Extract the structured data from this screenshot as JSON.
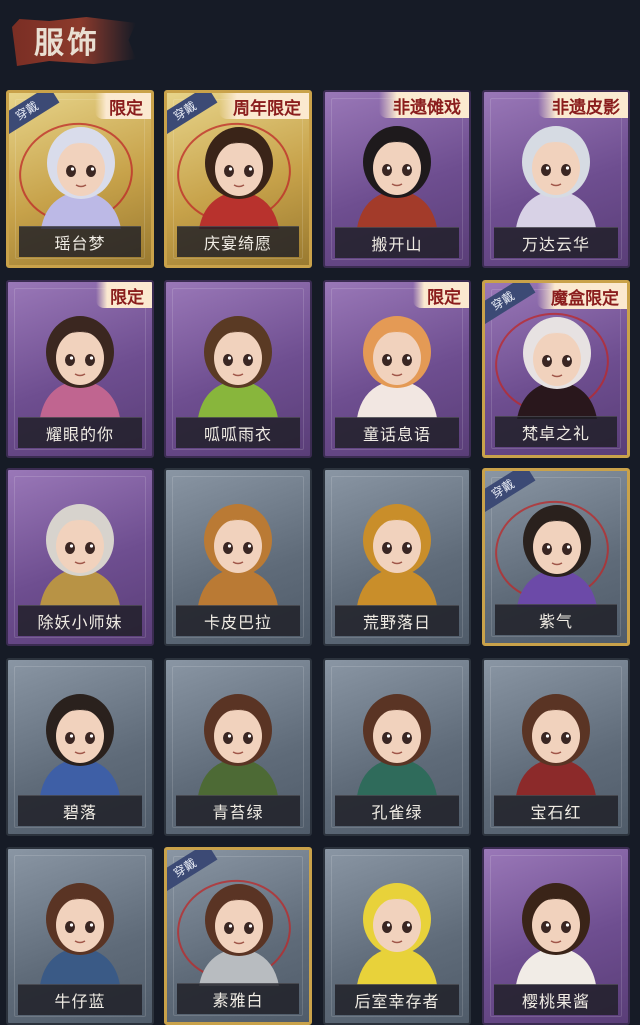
{
  "header": {
    "title": "服饰"
  },
  "cards": [
    {
      "name": "瑶台梦",
      "style": "gold",
      "tag": "限定",
      "equipped": true,
      "equip_label": "穿戴",
      "hair": "#d9dceb",
      "outfit": "#bcb9e6"
    },
    {
      "name": "庆宴绮愿",
      "style": "gold",
      "tag": "周年限定",
      "equipped": true,
      "equip_label": "穿戴",
      "hair": "#3a2418",
      "outfit": "#b8322d"
    },
    {
      "name": "搬开山",
      "style": "purple",
      "tag": "非遗傩戏",
      "equipped": false,
      "equip_label": "",
      "hair": "#1e1a1c",
      "outfit": "#a33b2a"
    },
    {
      "name": "万达云华",
      "style": "purple",
      "tag": "非遗皮影",
      "equipped": false,
      "equip_label": "",
      "hair": "#d6dbe3",
      "outfit": "#d8d2e6"
    },
    {
      "name": "耀眼的你",
      "style": "purple",
      "tag": "限定",
      "equipped": false,
      "equip_label": "",
      "hair": "#3b2720",
      "outfit": "#c06590"
    },
    {
      "name": "呱呱雨衣",
      "style": "purple",
      "tag": "",
      "equipped": false,
      "equip_label": "",
      "hair": "#5a3a24",
      "outfit": "#88b63c"
    },
    {
      "name": "童话息语",
      "style": "purple",
      "tag": "限定",
      "equipped": false,
      "equip_label": "",
      "hair": "#e49a55",
      "outfit": "#f2e7e2"
    },
    {
      "name": "梵卓之礼",
      "style": "purple",
      "tag": "魔盒限定",
      "equipped": true,
      "equip_label": "穿戴",
      "hair": "#e7e2e2",
      "outfit": "#29171c"
    },
    {
      "name": "除妖小师妹",
      "style": "purple",
      "tag": "",
      "equipped": false,
      "equip_label": "",
      "hair": "#d7d3cd",
      "outfit": "#b89345"
    },
    {
      "name": "卡皮巴拉",
      "style": "gray",
      "tag": "",
      "equipped": false,
      "equip_label": "",
      "hair": "#ba7a34",
      "outfit": "#ba7a34"
    },
    {
      "name": "荒野落日",
      "style": "gray",
      "tag": "",
      "equipped": false,
      "equip_label": "",
      "hair": "#c98e2a",
      "outfit": "#c98e2a"
    },
    {
      "name": "紫气",
      "style": "gray",
      "tag": "",
      "equipped": true,
      "equip_label": "穿戴",
      "hair": "#2a211d",
      "outfit": "#6c4aa8"
    },
    {
      "name": "碧落",
      "style": "gray",
      "tag": "",
      "equipped": false,
      "equip_label": "",
      "hair": "#2a211d",
      "outfit": "#3e5fa6"
    },
    {
      "name": "青苔绿",
      "style": "gray",
      "tag": "",
      "equipped": false,
      "equip_label": "",
      "hair": "#5a3424",
      "outfit": "#4d6a35"
    },
    {
      "name": "孔雀绿",
      "style": "gray",
      "tag": "",
      "equipped": false,
      "equip_label": "",
      "hair": "#5a3424",
      "outfit": "#2f6b5b"
    },
    {
      "name": "宝石红",
      "style": "gray",
      "tag": "",
      "equipped": false,
      "equip_label": "",
      "hair": "#5a3424",
      "outfit": "#8c2a2a"
    },
    {
      "name": "牛仔蓝",
      "style": "gray",
      "tag": "",
      "equipped": false,
      "equip_label": "",
      "hair": "#5a3424",
      "outfit": "#3a5a86"
    },
    {
      "name": "素雅白",
      "style": "gray",
      "tag": "",
      "equipped": true,
      "equip_label": "穿戴",
      "hair": "#5a3424",
      "outfit": "#b8bcc0"
    },
    {
      "name": "后室幸存者",
      "style": "gray",
      "tag": "",
      "equipped": false,
      "equip_label": "",
      "hair": "#e8d23a",
      "outfit": "#e8d23a"
    },
    {
      "name": "樱桃果酱",
      "style": "purple",
      "tag": "",
      "equipped": false,
      "equip_label": "",
      "hair": "#3a2418",
      "outfit": "#f1ece6"
    }
  ]
}
